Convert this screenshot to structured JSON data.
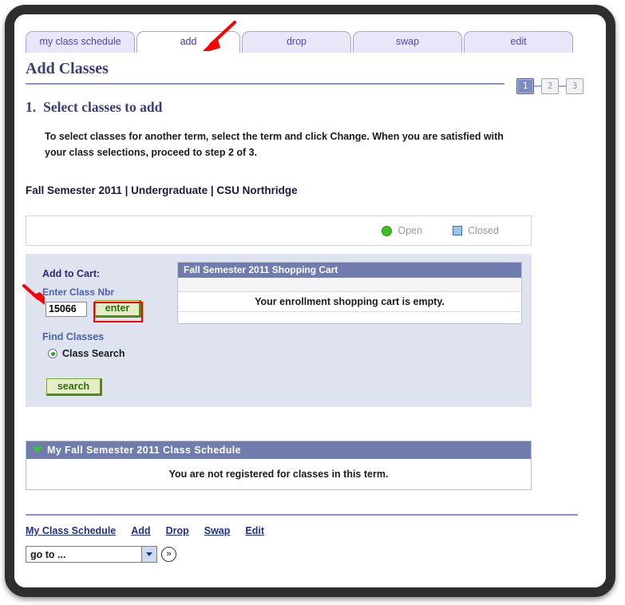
{
  "tabs": [
    {
      "label": "my class schedule",
      "active": false
    },
    {
      "label": "add",
      "active": true
    },
    {
      "label": "drop",
      "active": false
    },
    {
      "label": "swap",
      "active": false
    },
    {
      "label": "edit",
      "active": false
    }
  ],
  "page": {
    "title": "Add Classes",
    "step_number": "1.",
    "step_title": "Select classes to add",
    "instructions": "To select classes for another term, select the term and click Change.  When you are satisfied with your class selections, proceed to step 2 of 3.",
    "term_line": "Fall Semester 2011 | Undergraduate | CSU Northridge"
  },
  "steps": [
    {
      "label": "1",
      "active": true
    },
    {
      "label": "2",
      "active": false
    },
    {
      "label": "3",
      "active": false
    }
  ],
  "legend": {
    "open_label": "Open",
    "closed_label": "Closed",
    "open_color": "#3ec021",
    "closed_color": "#9cc3e8"
  },
  "add_to_cart": {
    "heading": "Add to Cart:",
    "class_nbr_label": "Enter Class Nbr",
    "class_nbr_value": "15066",
    "enter_button": "enter",
    "find_classes_label": "Find Classes",
    "class_search_label": "Class Search",
    "search_button": "search"
  },
  "cart": {
    "header": "Fall Semester 2011 Shopping Cart",
    "empty_message": "Your enrollment shopping cart is empty."
  },
  "schedule": {
    "header": "My Fall Semester 2011 Class Schedule",
    "message": "You are not registered for classes in this term."
  },
  "footer": {
    "links": [
      "My Class Schedule",
      "Add",
      "Drop",
      "Swap",
      "Edit"
    ],
    "goto_value": "go to ...",
    "goto_button": "»"
  },
  "annotations": {
    "accent_color": "#ff0000"
  }
}
